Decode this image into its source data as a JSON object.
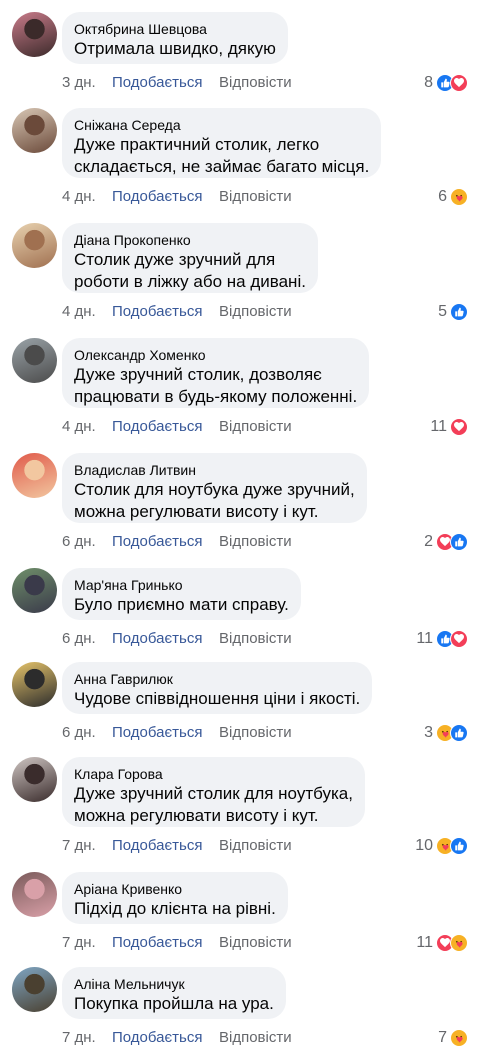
{
  "ui": {
    "like_label": "Подобається",
    "reply_label": "Відповісти",
    "colors": {
      "bubble": "#f0f2f5",
      "link": "#385898",
      "meta": "#65676b",
      "like": "#1877f2",
      "love": "#f33e58",
      "care": "#f7b125"
    }
  },
  "comments": [
    {
      "author": "Октябрина Шевцова",
      "text": "Отримала швидко, дякую",
      "time": "3 дн.",
      "reaction_count": "8",
      "reactions": [
        "like-icon",
        "love-icon"
      ],
      "avatar_colors": [
        "#c97b8a",
        "#3b2a2a"
      ]
    },
    {
      "author": "Сніжана Середа",
      "text": "Дуже практичний столик, легко\nскладається, не займає багато місця.",
      "time": "4 дн.",
      "reaction_count": "6",
      "reactions": [
        "care-icon"
      ],
      "avatar_colors": [
        "#d8c7b5",
        "#6b4a3a"
      ]
    },
    {
      "author": "Діана Прокопенко",
      "text": "Столик дуже зручний для\nроботи в ліжку або на дивані.",
      "time": "4 дн.",
      "reaction_count": "5",
      "reactions": [
        "like-icon"
      ],
      "avatar_colors": [
        "#e8d2b0",
        "#a07050"
      ]
    },
    {
      "author": "Олександр Хоменко",
      "text": "Дуже зручний столик, дозволяє\nпрацювати в будь-якому положенні.",
      "time": "4 дн.",
      "reaction_count": "11",
      "reactions": [
        "love-icon"
      ],
      "avatar_colors": [
        "#9aa3a8",
        "#4b4b4b"
      ]
    },
    {
      "author": "Владислав Литвин",
      "text": "Столик для ноутбука дуже зручний,\nможна регулювати висоту і кут.",
      "time": "6 дн.",
      "reaction_count": "2",
      "reactions": [
        "love-icon",
        "like-icon"
      ],
      "avatar_colors": [
        "#e05a4a",
        "#f2c7a0"
      ]
    },
    {
      "author": "Мар'яна Гринько",
      "text": "Було приємно мати справу.",
      "time": "6 дн.",
      "reaction_count": "11",
      "reactions": [
        "like-icon",
        "love-icon"
      ],
      "avatar_colors": [
        "#6f8f6a",
        "#3a3a4a"
      ]
    },
    {
      "author": "Анна Гаврилюк",
      "text": "Чудове співвідношення ціни і якості.",
      "time": "6 дн.",
      "reaction_count": "3",
      "reactions": [
        "care-icon",
        "like-icon"
      ],
      "avatar_colors": [
        "#e6c46a",
        "#2c2c2c"
      ]
    },
    {
      "author": "Клара Горова",
      "text": "Дуже зручний столик для ноутбука,\nможна регулювати висоту і кут.",
      "time": "7 дн.",
      "reaction_count": "10",
      "reactions": [
        "care-icon",
        "like-icon"
      ],
      "avatar_colors": [
        "#cfc6c3",
        "#3a2c2c"
      ]
    },
    {
      "author": "Аріана Кривенко",
      "text": "Підхід до клієнта на рівні.",
      "time": "7 дн.",
      "reaction_count": "11",
      "reactions": [
        "love-icon",
        "care-icon"
      ],
      "avatar_colors": [
        "#7a5a5a",
        "#d9a0a8"
      ]
    },
    {
      "author": "Аліна Мельничук",
      "text": "Покупка пройшла на ура.",
      "time": "7 дн.",
      "reaction_count": "7",
      "reactions": [
        "care-icon"
      ],
      "avatar_colors": [
        "#7fa6c4",
        "#4a4030"
      ]
    }
  ]
}
